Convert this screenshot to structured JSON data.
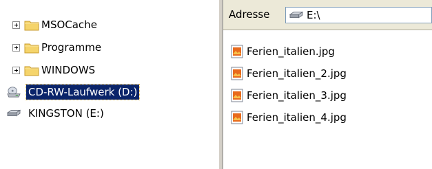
{
  "tree": {
    "items": [
      {
        "label": "MSOCache",
        "icon": "folder-icon",
        "expandable": true
      },
      {
        "label": "Programme",
        "icon": "folder-icon",
        "expandable": true
      },
      {
        "label": "WINDOWS",
        "icon": "folder-icon",
        "expandable": true
      },
      {
        "label": "CD-RW-Laufwerk (D:)",
        "icon": "cd-drive-icon",
        "expandable": false,
        "selected": true
      },
      {
        "label": "KINGSTON (E:)",
        "icon": "removable-drive-icon",
        "expandable": false
      }
    ]
  },
  "address": {
    "label": "Adresse",
    "value": "E:\\",
    "icon": "removable-drive-icon"
  },
  "files": [
    {
      "name": "Ferien_italien.jpg",
      "icon": "jpg-file-icon"
    },
    {
      "name": "Ferien_italien_2.jpg",
      "icon": "jpg-file-icon"
    },
    {
      "name": "Ferien_italien_3.jpg",
      "icon": "jpg-file-icon"
    },
    {
      "name": "Ferien_italien_4.jpg",
      "icon": "jpg-file-icon"
    }
  ],
  "colors": {
    "selection_background": "#0a246a",
    "selection_text": "#ffffff",
    "toolbar_background": "#ece9d8",
    "folder_yellow": "#f5d46b"
  }
}
